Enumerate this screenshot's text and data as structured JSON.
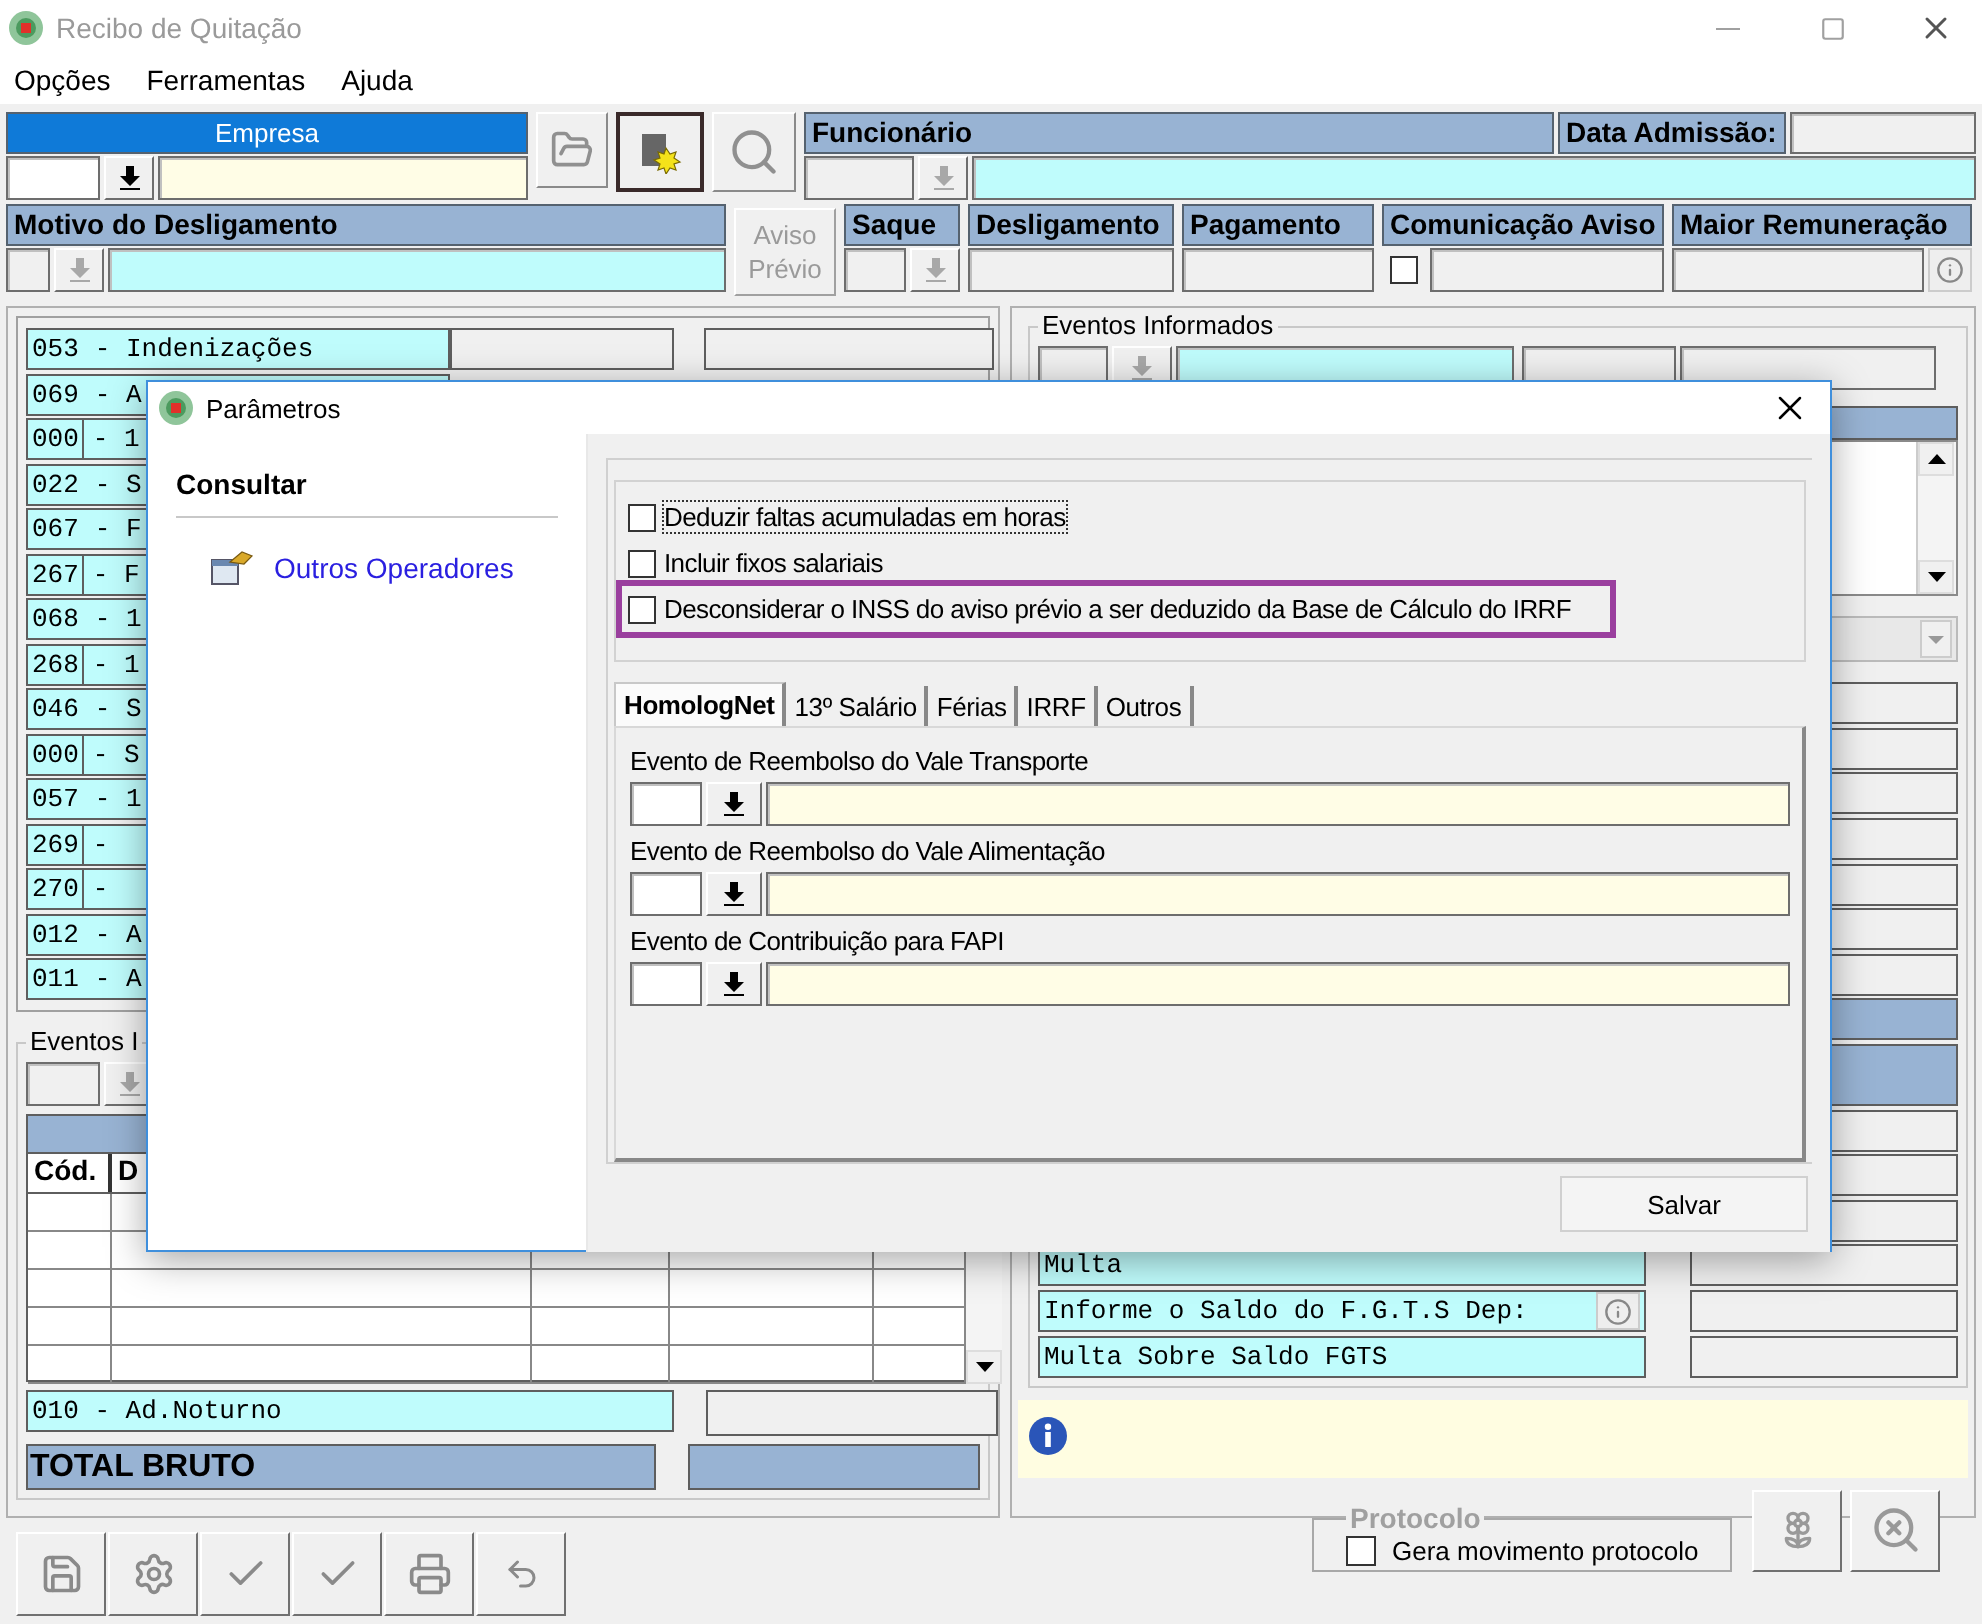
{
  "window": {
    "title": "Recibo de Quitação"
  },
  "menu": [
    {
      "label": "Opções"
    },
    {
      "label": "Ferramentas"
    },
    {
      "label": "Ajuda"
    }
  ],
  "empresa": {
    "label": "Empresa"
  },
  "funcionario": {
    "label": "Funcionário"
  },
  "data_admissao": {
    "label": "Data Admissão:"
  },
  "motivo": {
    "label": "Motivo do Desligamento"
  },
  "aviso_previo": {
    "label": "Aviso Prévio",
    "disabled": true
  },
  "date_fields": [
    {
      "label": "Saque",
      "kind": "lookup"
    },
    {
      "label": "Desligamento",
      "kind": "plain"
    },
    {
      "label": "Pagamento",
      "kind": "plain"
    }
  ],
  "comunicacao_aviso": {
    "label": "Comunicação Aviso",
    "checked": false
  },
  "maior_remuneracao": {
    "label": "Maior Remuneração"
  },
  "event_list": [
    {
      "code": "053",
      "text": "- Indenizações",
      "split": false
    },
    {
      "code": "069",
      "text": "- A",
      "split": false
    },
    {
      "code": "000",
      "text": "- 1",
      "split": true
    },
    {
      "code": "022",
      "text": "- S",
      "split": false
    },
    {
      "code": "067",
      "text": "- F",
      "split": false
    },
    {
      "code": "267",
      "text": "- F",
      "split": true
    },
    {
      "code": "068",
      "text": "- 1",
      "split": false
    },
    {
      "code": "268",
      "text": "- 1",
      "split": true
    },
    {
      "code": "046",
      "text": "- S",
      "split": false
    },
    {
      "code": "000",
      "text": "- S",
      "split": true
    },
    {
      "code": "057",
      "text": "- 1",
      "split": false
    },
    {
      "code": "269",
      "text": "-",
      "split": true
    },
    {
      "code": "270",
      "text": "-",
      "split": true
    },
    {
      "code": "012",
      "text": "- A",
      "split": false
    },
    {
      "code": "011",
      "text": "- A",
      "split": false
    }
  ],
  "eventos_lower": {
    "legend": "Eventos I",
    "columns": [
      {
        "label": "Cód."
      },
      {
        "label": "D"
      }
    ]
  },
  "summary_rows": [
    {
      "kind": "event",
      "text": "010 - Ad.Noturno"
    },
    {
      "kind": "total",
      "text": "TOTAL BRUTO"
    }
  ],
  "toolbar": [
    {
      "kind": "save"
    },
    {
      "kind": "settings"
    },
    {
      "kind": "check"
    },
    {
      "kind": "check"
    },
    {
      "kind": "print"
    },
    {
      "kind": "undo"
    }
  ],
  "eventos_informados": {
    "legend": "Eventos Informados"
  },
  "fgts_rows": [
    {
      "text": "Multa",
      "info": false
    },
    {
      "text": "Informe o Saldo do F.G.T.S Dep:",
      "info": true
    },
    {
      "text": "Multa Sobre Saldo FGTS",
      "info": false
    }
  ],
  "protocolo": {
    "legend": "Protocolo",
    "option": "Gera movimento protocolo",
    "checked": false
  },
  "dialog": {
    "title": "Parâmetros",
    "sidebar": {
      "heading": "Consultar",
      "items": [
        {
          "label": "Outros Operadores"
        }
      ]
    },
    "options": [
      {
        "label": "Deduzir faltas acumuladas em horas",
        "checked": false,
        "focused": true,
        "highlighted": false
      },
      {
        "label": "Incluir fixos salariais",
        "checked": false,
        "focused": false,
        "highlighted": false
      },
      {
        "label": "Desconsiderar o INSS do aviso prévio a ser deduzido da Base de Cálculo do IRRF",
        "checked": false,
        "focused": false,
        "highlighted": true
      }
    ],
    "tabs": [
      {
        "label": "HomologNet",
        "selected": true
      },
      {
        "label": "13º Salário",
        "selected": false
      },
      {
        "label": "Férias",
        "selected": false
      },
      {
        "label": "IRRF",
        "selected": false
      },
      {
        "label": "Outros",
        "selected": false
      }
    ],
    "fields": [
      {
        "label": "Evento de Reembolso do Vale Transporte"
      },
      {
        "label": "Evento de Reembolso do Vale Alimentação"
      },
      {
        "label": "Evento de Contribuição para FAPI"
      }
    ],
    "save_button": "Salvar"
  }
}
